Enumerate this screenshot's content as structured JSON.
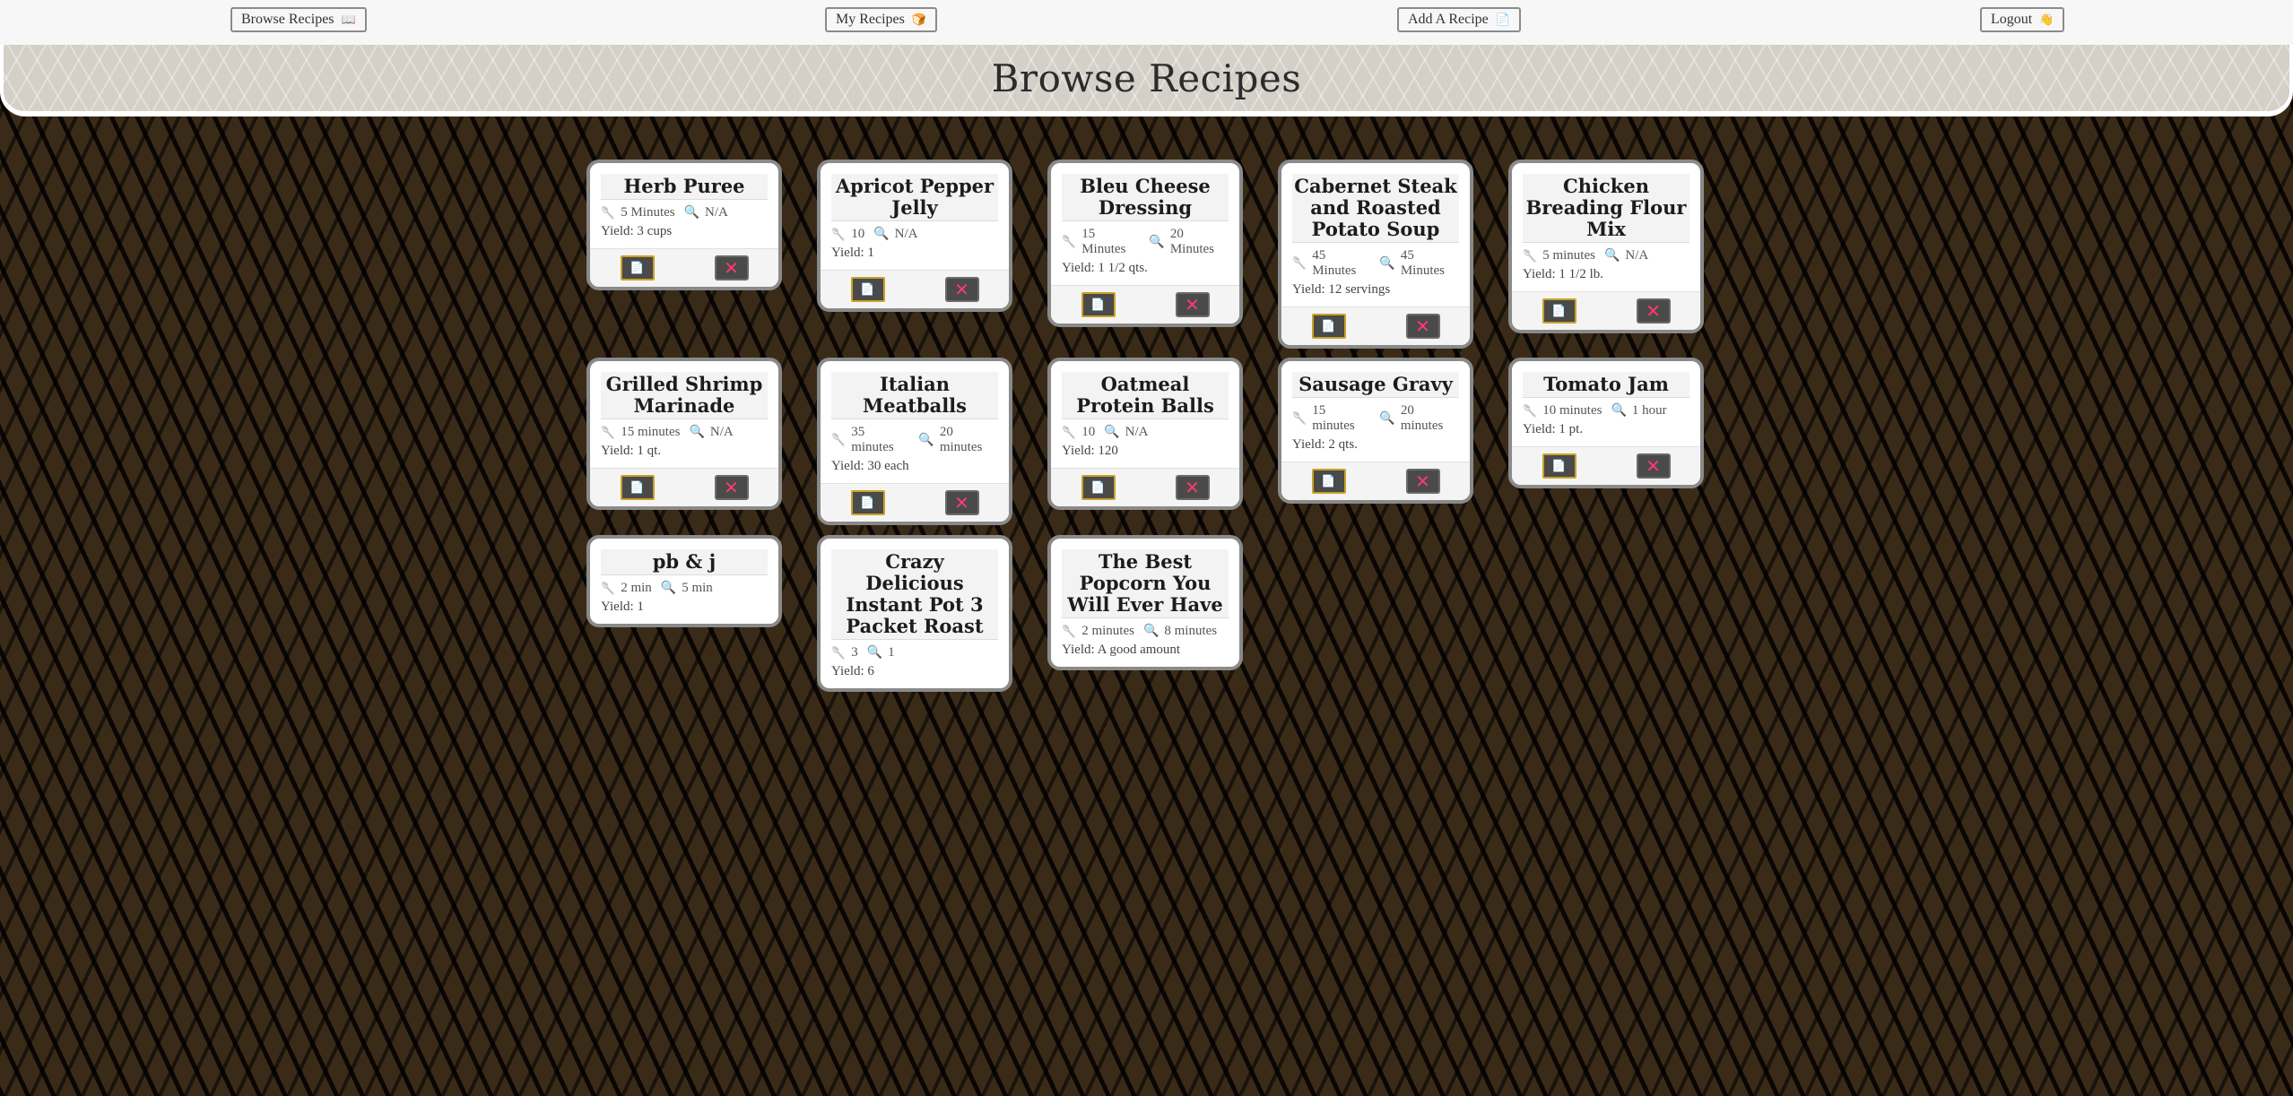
{
  "nav": {
    "browse": {
      "label": "Browse Recipes",
      "icon": "📖"
    },
    "mine": {
      "label": "My Recipes",
      "icon": "🍞"
    },
    "add": {
      "label": "Add A Recipe",
      "icon": "📄"
    },
    "logout": {
      "label": "Logout",
      "icon": "👋"
    }
  },
  "page_title": "Browse Recipes",
  "icons": {
    "prep": "🥄",
    "cook": "🔍",
    "view": "📄",
    "delete": "✕"
  },
  "recipes": [
    {
      "title": "Herb Puree",
      "prep": "5 Minutes",
      "cook": "N/A",
      "yield": "Yield: 3 cups"
    },
    {
      "title": "Apricot Pepper Jelly",
      "prep": "10",
      "cook": "N/A",
      "yield": "Yield: 1"
    },
    {
      "title": "Bleu Cheese Dressing",
      "prep": "15 Minutes",
      "cook": "20 Minutes",
      "yield": "Yield: 1 1/2 qts."
    },
    {
      "title": "Cabernet Steak and Roasted Potato Soup",
      "prep": "45 Minutes",
      "cook": "45 Minutes",
      "yield": "Yield: 12 servings"
    },
    {
      "title": "Chicken Breading Flour Mix",
      "prep": "5 minutes",
      "cook": "N/A",
      "yield": "Yield: 1 1/2 lb."
    },
    {
      "title": "Grilled Shrimp Marinade",
      "prep": "15 minutes",
      "cook": "N/A",
      "yield": "Yield: 1 qt."
    },
    {
      "title": "Italian Meatballs",
      "prep": "35 minutes",
      "cook": "20 minutes",
      "yield": "Yield: 30 each"
    },
    {
      "title": "Oatmeal Protein Balls",
      "prep": "10",
      "cook": "N/A",
      "yield": "Yield: 120"
    },
    {
      "title": "Sausage Gravy",
      "prep": "15 minutes",
      "cook": "20 minutes",
      "yield": "Yield: 2 qts."
    },
    {
      "title": "Tomato Jam",
      "prep": "10 minutes",
      "cook": "1 hour",
      "yield": "Yield: 1 pt."
    },
    {
      "title": "pb & j",
      "prep": "2 min",
      "cook": "5 min",
      "yield": "Yield: 1"
    },
    {
      "title": "Crazy Delicious Instant Pot 3 Packet Roast",
      "prep": "3",
      "cook": "1",
      "yield": "Yield: 6"
    },
    {
      "title": "The Best Popcorn You Will Ever Have",
      "prep": "2 minutes",
      "cook": "8 minutes",
      "yield": "Yield: A good amount"
    }
  ]
}
